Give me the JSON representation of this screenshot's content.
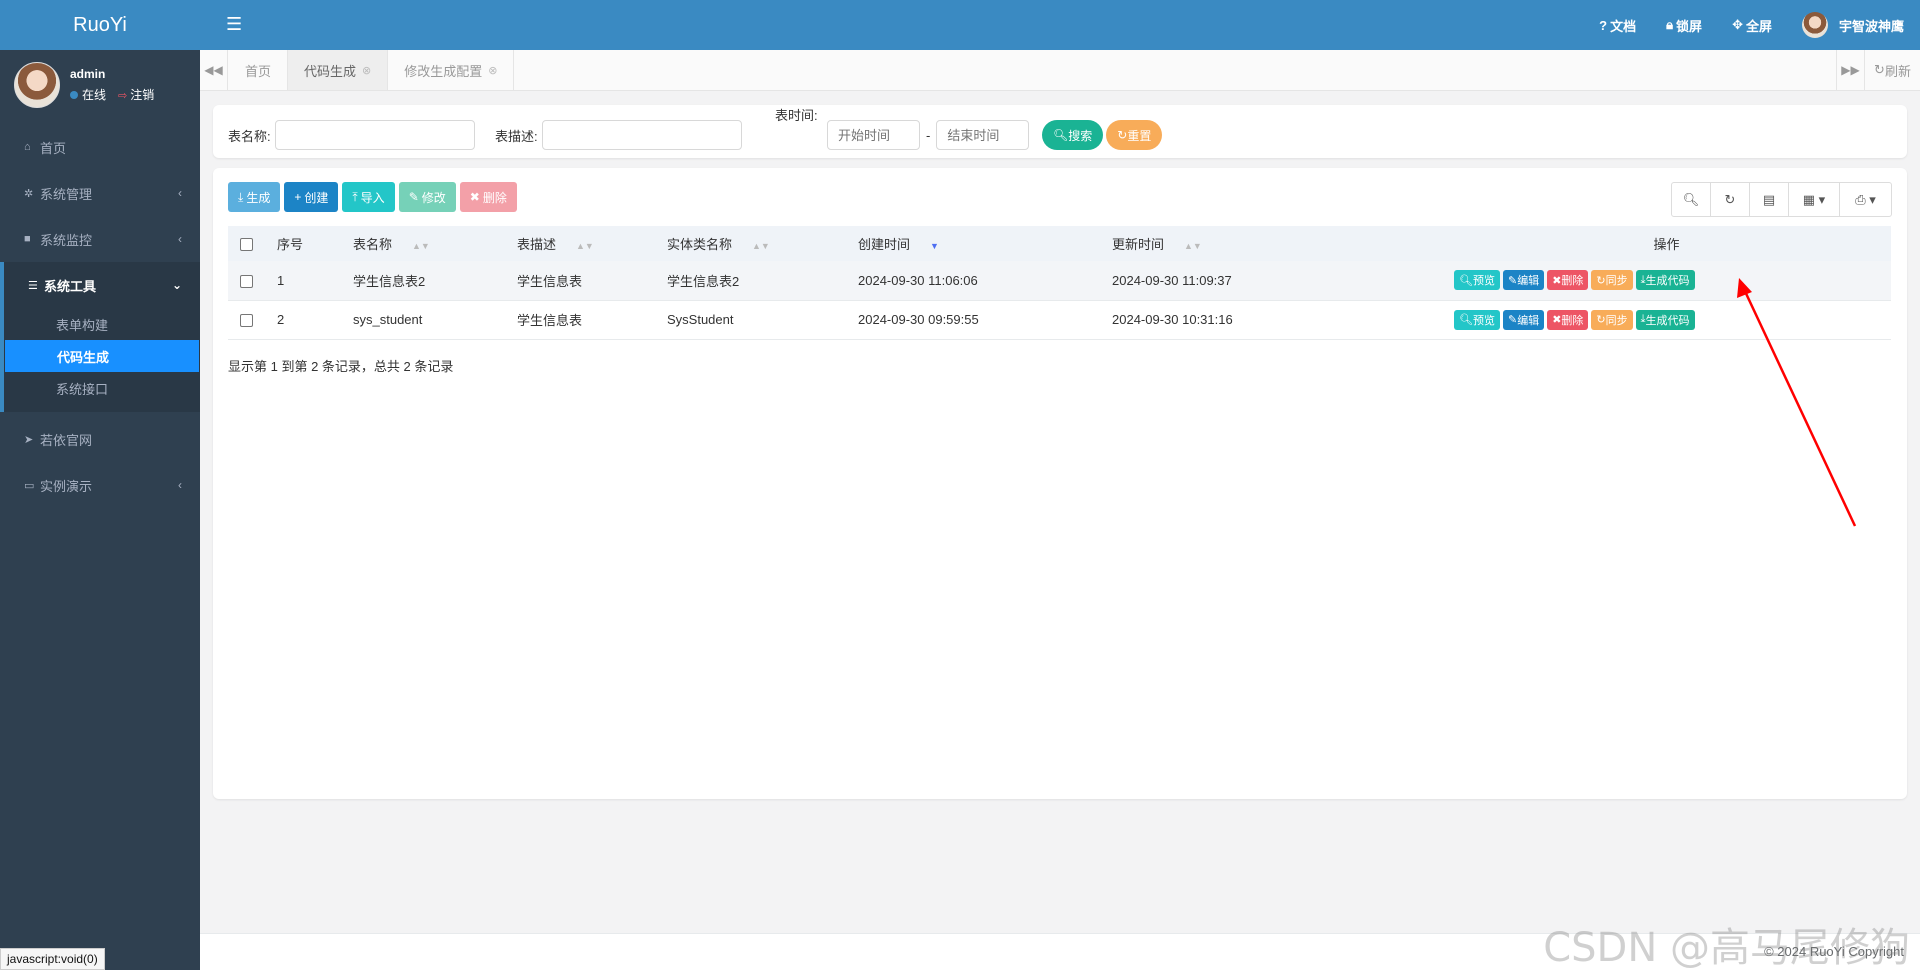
{
  "app": {
    "logo": "RuoYi"
  },
  "user": {
    "name": "admin",
    "status": "在线",
    "logout": "注销"
  },
  "sidebar": {
    "items": [
      {
        "icon": "home-icon",
        "label": "首页"
      },
      {
        "icon": "gear-icon",
        "label": "系统管理"
      },
      {
        "icon": "video-icon",
        "label": "系统监控"
      },
      {
        "icon": "bars-icon",
        "label": "系统工具"
      },
      {
        "icon": "send-icon",
        "label": "若依官网"
      },
      {
        "icon": "desktop-icon",
        "label": "实例演示"
      }
    ],
    "submenu": [
      "表单构建",
      "代码生成",
      "系统接口"
    ]
  },
  "topbar": {
    "docs": "文档",
    "lock": "锁屏",
    "fullscreen": "全屏",
    "username": "宇智波神鹰"
  },
  "tabs": [
    "首页",
    "代码生成",
    "修改生成配置"
  ],
  "refresh_label": "刷新",
  "search": {
    "table_name_label": "表名称:",
    "table_desc_label": "表描述:",
    "table_time_label": "表时间:",
    "start_placeholder": "开始时间",
    "end_placeholder": "结束时间",
    "dash": "-",
    "search_btn": "搜索",
    "reset_btn": "重置"
  },
  "toolbar": {
    "generate": "生成",
    "create": "创建",
    "import": "导入",
    "edit": "修改",
    "delete": "删除"
  },
  "table": {
    "headers": [
      "序号",
      "表名称",
      "表描述",
      "实体类名称",
      "创建时间",
      "更新时间",
      "操作"
    ],
    "rows": [
      {
        "no": "1",
        "name": "学生信息表2",
        "desc": "学生信息表",
        "entity": "学生信息表2",
        "created": "2024-09-30 11:06:06",
        "updated": "2024-09-30 11:09:37"
      },
      {
        "no": "2",
        "name": "sys_student",
        "desc": "学生信息表",
        "entity": "SysStudent",
        "created": "2024-09-30 09:59:55",
        "updated": "2024-09-30 10:31:16"
      }
    ],
    "ops": {
      "preview": "预览",
      "edit": "编辑",
      "delete": "删除",
      "sync": "同步",
      "gencode": "生成代码"
    }
  },
  "pagination_text": "显示第 1 到第 2 条记录，总共 2 条记录",
  "footer": "© 2024 RuoYi Copyright",
  "watermark": "CSDN @高马尾修狗",
  "statusbar": "javascript:void(0)",
  "colors": {
    "brand": "#3a8ac2",
    "sidebar": "#2f4050",
    "active_sub": "#1890ff",
    "annotation": "#ff0000"
  }
}
